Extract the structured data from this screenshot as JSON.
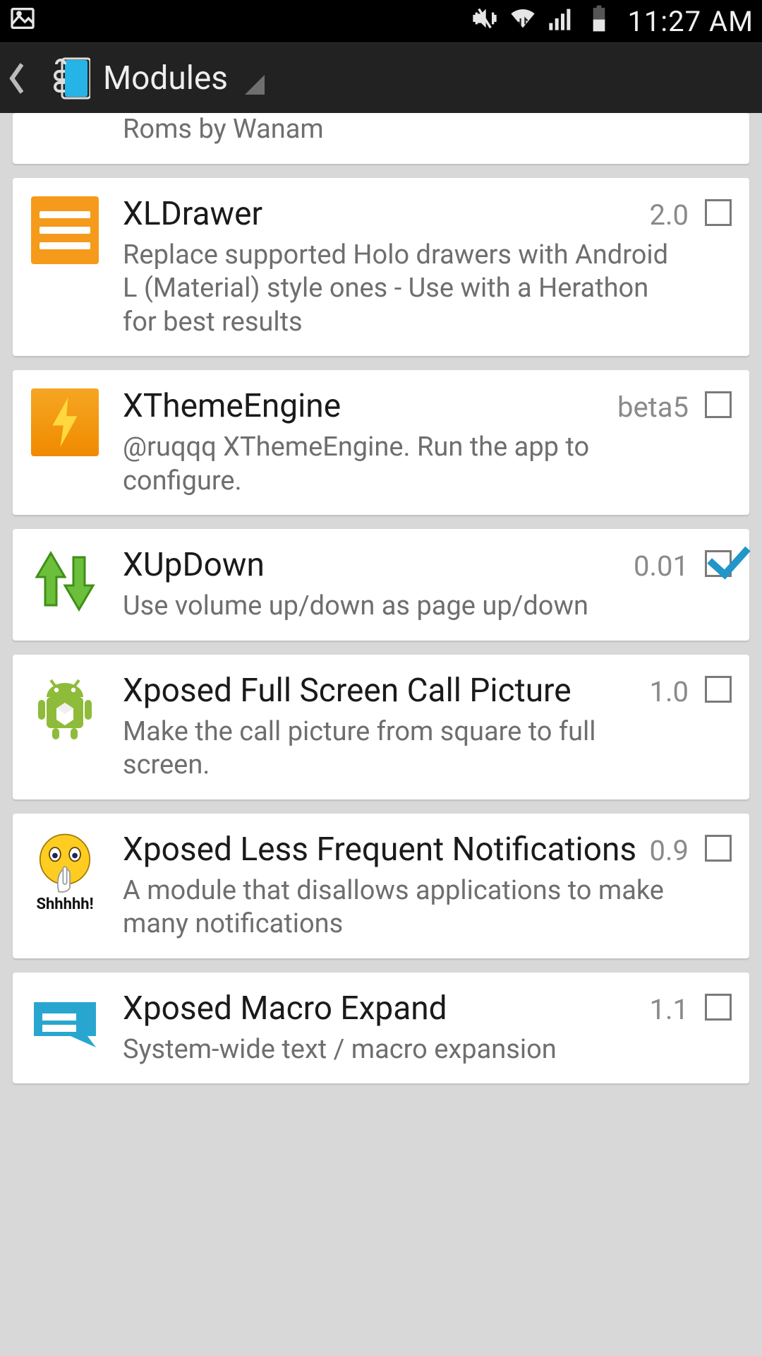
{
  "status": {
    "time": "11:27 AM"
  },
  "header": {
    "title": "Modules"
  },
  "modules": [
    {
      "name": "",
      "version": "",
      "description": "Roms by Wanam",
      "checked": false,
      "icon": "wanam"
    },
    {
      "name": "XLDrawer",
      "version": "2.0",
      "description": "Replace supported Holo drawers with Android L (Material) style ones - Use with a Herathon for best results",
      "checked": false,
      "icon": "xldrawer"
    },
    {
      "name": "XThemeEngine",
      "version": "beta5",
      "description": "@ruqqq XThemeEngine. Run the app to configure.",
      "checked": false,
      "icon": "xtheme"
    },
    {
      "name": "XUpDown",
      "version": "0.01",
      "description": "Use volume up/down as page up/down",
      "checked": true,
      "icon": "xupdown"
    },
    {
      "name": "Xposed Full Screen Call Picture",
      "version": "1.0",
      "description": "Make the call picture from square to full screen.",
      "checked": false,
      "icon": "callpic"
    },
    {
      "name": "Xposed Less Frequent Notifications",
      "version": "0.9",
      "description": "A module that disallows applications to make many notifications",
      "checked": false,
      "icon": "shhh"
    },
    {
      "name": "Xposed Macro Expand",
      "version": "1.1",
      "description": "System-wide text / macro expansion",
      "checked": false,
      "icon": "macro"
    }
  ],
  "icon_labels": {
    "shhh_text": "Shhhhh!"
  }
}
